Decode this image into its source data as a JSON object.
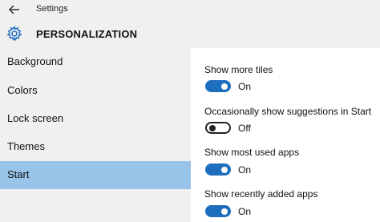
{
  "titlebar": {
    "title": "Settings",
    "back_icon": "back-arrow-icon"
  },
  "header": {
    "icon": "gear-icon",
    "title": "PERSONALIZATION"
  },
  "sidebar": {
    "items": [
      {
        "label": "Background",
        "selected": false
      },
      {
        "label": "Colors",
        "selected": false
      },
      {
        "label": "Lock screen",
        "selected": false
      },
      {
        "label": "Themes",
        "selected": false
      },
      {
        "label": "Start",
        "selected": true
      }
    ],
    "selected_color": "#99c4ea"
  },
  "settings": [
    {
      "label": "Show more tiles",
      "state": "On",
      "enabled": true
    },
    {
      "label": "Occasionally show suggestions in Start",
      "state": "Off",
      "enabled": false
    },
    {
      "label": "Show most used apps",
      "state": "On",
      "enabled": true
    },
    {
      "label": "Show recently added apps",
      "state": "On",
      "enabled": true
    }
  ],
  "colors": {
    "accent": "#1e6ebe",
    "chrome_background": "#f0f0f0"
  }
}
